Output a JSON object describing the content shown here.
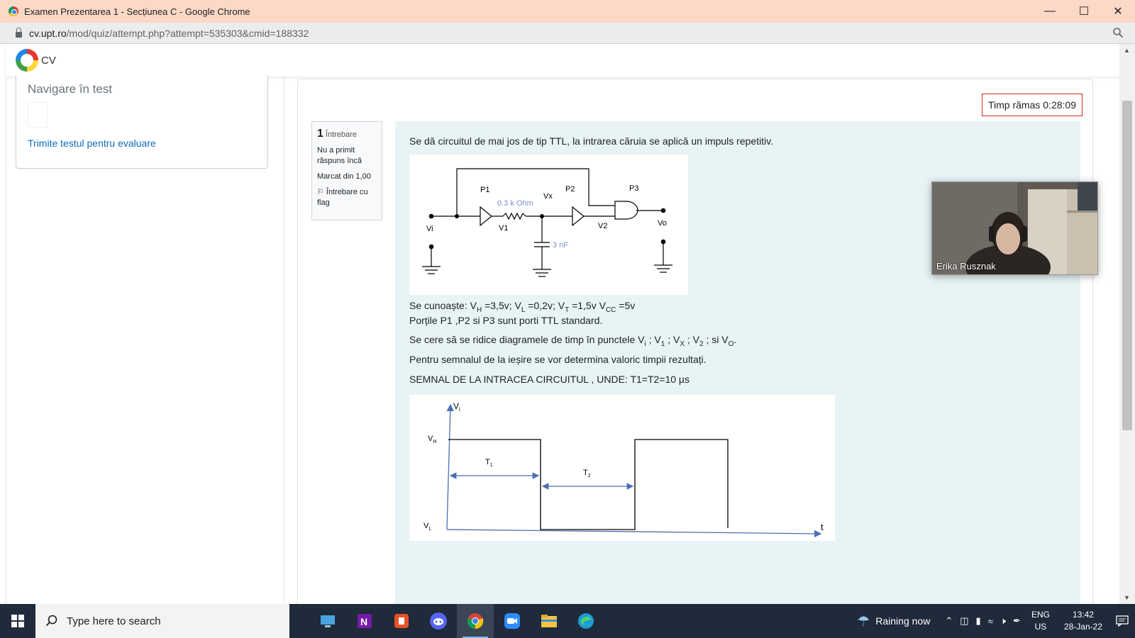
{
  "browser": {
    "window_title": "Examen Prezentarea 1 - Secțiunea C - Google Chrome",
    "url_host": "cv.upt.ro",
    "url_path": "/mod/quiz/attempt.php?attempt=535303&cmid=188332"
  },
  "header": {
    "site_name": "CV"
  },
  "nav_block": {
    "title": "Navigare în test",
    "submit_link": "Trimite testul pentru evaluare"
  },
  "timer": {
    "label": "Timp rămas 0:28:09"
  },
  "question_info": {
    "number": "1",
    "word": "Întrebare",
    "status": "Nu a primit răspuns încă",
    "mark": "Marcat din 1,00",
    "flag": "Întrebare cu flag"
  },
  "question": {
    "intro": "Se dă circuitul de mai jos de tip TTL, la intrarea căruia se aplică un impuls repetitiv.",
    "known_prefix": "Se cunoaște: ",
    "vh_sub": "H",
    "vh_val": " =3,5v;   V",
    "vl_sub": "L",
    "vl_val": " =0,2v;  V",
    "vt_sub": "T",
    "vt_val": " =1,5v  V",
    "vcc_sub": "CC",
    "vcc_val": " =5v",
    "gates_line": "Porțile P1 ,P2 si  P3 sunt porti TTL standard.",
    "ask_prefix": "Se cere să se ridice diagramele de timp în punctele V",
    "ask_i": "i",
    "ask_v1": " ;  V",
    "ask_1": "1",
    "ask_vx": " ;  V",
    "ask_x": "X",
    "ask_v2": " ;  V",
    "ask_2": "2",
    "ask_vo": " ;  si   V",
    "ask_o": "O",
    "ask_end": ".",
    "output_line": "Pentru semnalul de la ieșire se vor determina valoric timpii rezultați.",
    "signal_line": "SEMNAL DE LA INTRACEA CIRCUITUL , UNDE: T1=T2=10 µs"
  },
  "circuit": {
    "label_p1": "P1",
    "label_p2": "P2",
    "label_p3": "P3",
    "label_vx": "Vx",
    "label_vi": "Vi",
    "label_v1": "V1",
    "label_v2": "V2",
    "label_vo": "Vo",
    "resistor": "0.3 k Ohm",
    "capacitor": "3 nF"
  },
  "timing": {
    "y_label": "V",
    "y_sub": "i",
    "vh": "V",
    "vh_sub": "H",
    "vl": "V",
    "vl_sub": "L",
    "t1": "T",
    "t1_sub": "1",
    "t2": "T",
    "t2_sub": "2",
    "x_label": "t"
  },
  "webcam": {
    "name": "Erika Rusznak"
  },
  "taskbar": {
    "search_placeholder": "Type here to search",
    "weather": "Raining now",
    "lang1": "ENG",
    "lang2": "US",
    "time": "13:42",
    "date": "28-Jan-22"
  }
}
